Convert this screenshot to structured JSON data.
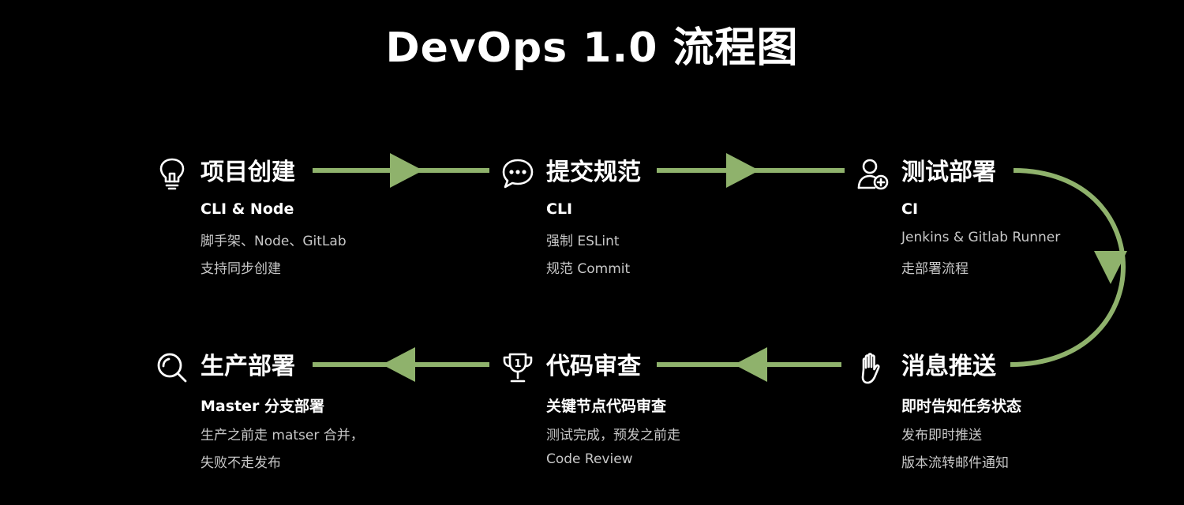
{
  "title": "DevOps 1.0 流程图",
  "colors": {
    "background": "#000000",
    "connector": "#8fb26c",
    "text": "#ffffff",
    "muted": "#c8c8c8"
  },
  "steps": [
    {
      "icon": "lightbulb-icon",
      "name": "项目创建",
      "sub": "CLI & Node",
      "desc": [
        "脚手架、Node、GitLab",
        "支持同步创建"
      ]
    },
    {
      "icon": "chat-bubble-icon",
      "name": "提交规范",
      "sub": "CLI",
      "desc": [
        "强制 ESLint",
        "规范 Commit"
      ]
    },
    {
      "icon": "user-add-icon",
      "name": "测试部署",
      "sub": "CI",
      "desc": [
        "Jenkins & Gitlab Runner",
        "走部署流程"
      ]
    },
    {
      "icon": "hand-icon",
      "name": "消息推送",
      "sub": "即时告知任务状态",
      "desc": [
        "发布即时推送",
        "版本流转邮件通知"
      ]
    },
    {
      "icon": "trophy-icon",
      "name": "代码审查",
      "sub": "关键节点代码审查",
      "desc": [
        "测试完成，预发之前走",
        "Code Review"
      ]
    },
    {
      "icon": "search-icon",
      "name": "生产部署",
      "sub": "Master 分支部署",
      "desc": [
        "生产之前走 matser 合并，",
        "失败不走发布"
      ]
    }
  ],
  "trophy_digit": "1"
}
